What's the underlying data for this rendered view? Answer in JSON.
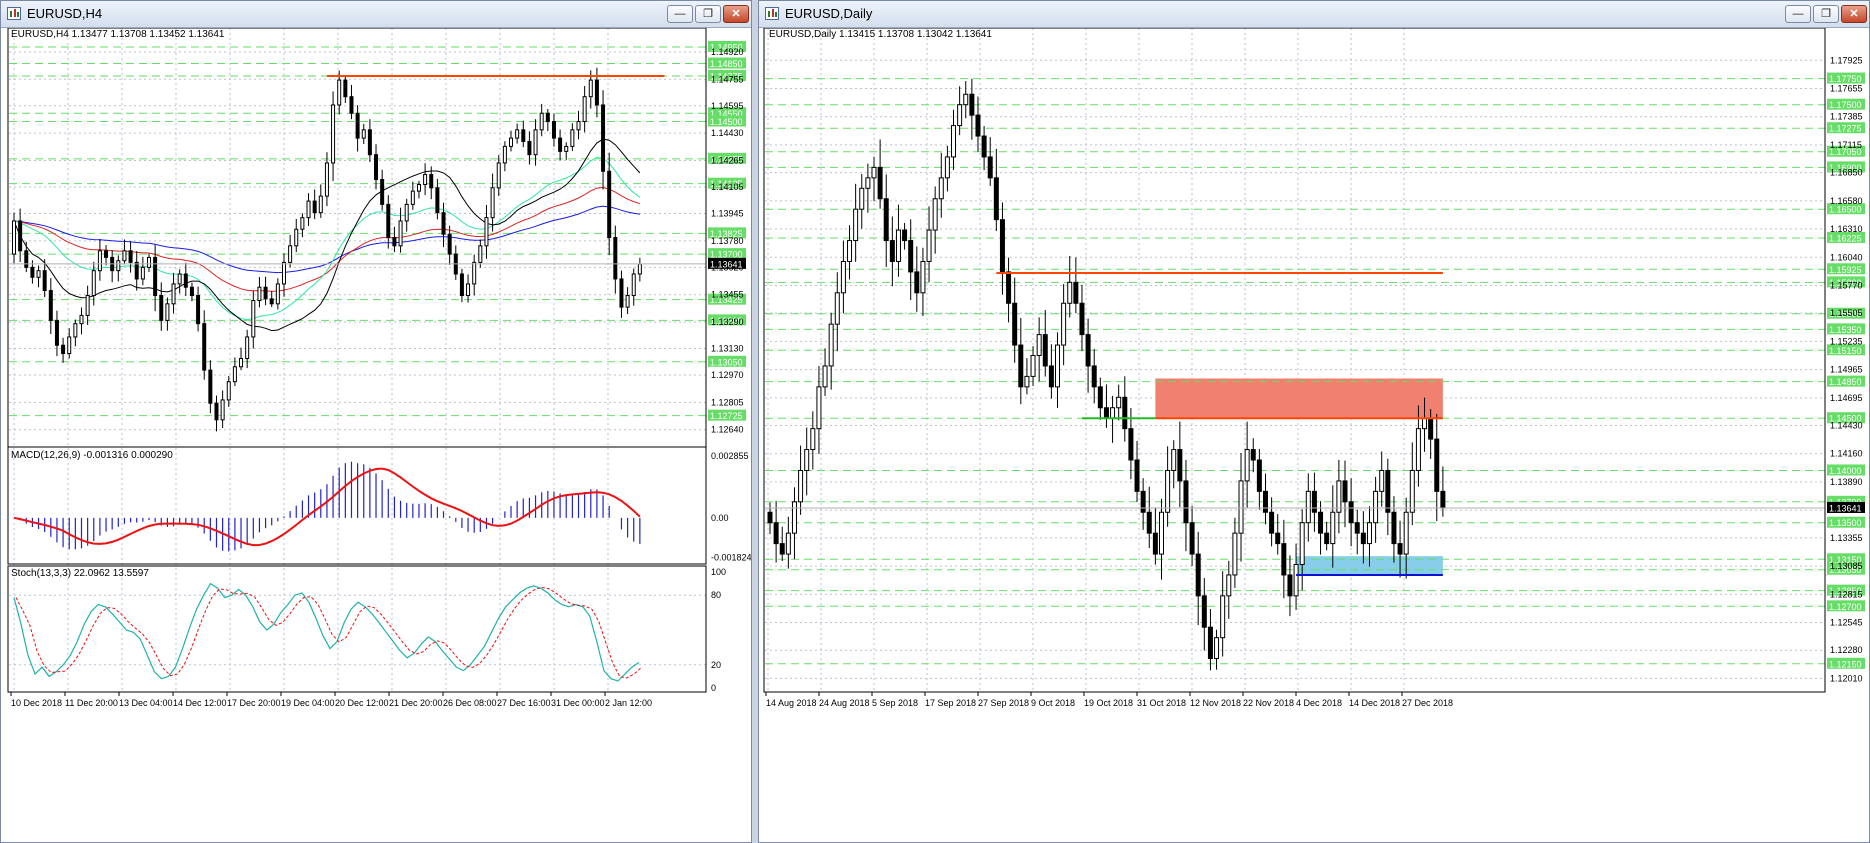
{
  "left_window": {
    "title": "EURUSD,H4",
    "header_label": "EURUSD,H4  1.13477 1.13708 1.13452 1.13641",
    "macd_label": "MACD(12,26,9) -0.001316 0.000290",
    "stoch_label": "Stoch(13,3,3) 22.0962 13.5597",
    "buttons": {
      "minimize": "—",
      "restore": "❐",
      "close": "✕"
    }
  },
  "right_window": {
    "title": "EURUSD,Daily",
    "header_label": "EURUSD,Daily  1.13415 1.13708 1.13042 1.13641",
    "buttons": {
      "minimize": "—",
      "restore": "❐",
      "close": "✕"
    }
  },
  "colors": {
    "bull": "#ffffff",
    "bear": "#000000",
    "grid": "#b9c3cf",
    "level": "#66dd66",
    "resistance": "#ff4500",
    "support_line": "#1010d0",
    "green_line": "#22bb22",
    "zone_red": "#f08070",
    "zone_blue": "#87ceeb",
    "macd_hist": "#2222cc",
    "signal": "#ee1111",
    "stoch_main": "#20b2aa",
    "stoch_signal": "#ee1111",
    "ma_black": "#000000",
    "ma_teal": "#2ee8a0",
    "ma_red": "#dd2222",
    "ma_blue": "#1a1aee"
  },
  "chart_data": [
    {
      "type": "candlestick",
      "id": "h4",
      "title": "EURUSD,H4",
      "ylim": [
        1.1256,
        1.1498
      ],
      "yticks": [
        1.1492,
        1.14755,
        1.14595,
        1.1443,
        1.14265,
        1.14105,
        1.13945,
        1.1378,
        1.1362,
        1.13455,
        1.1329,
        1.1313,
        1.1297,
        1.12805,
        1.1264
      ],
      "green_levels": [
        1.1495,
        1.1485,
        1.14775,
        1.1455,
        1.145,
        1.14275,
        1.14125,
        1.13825,
        1.137,
        1.13425,
        1.133,
        1.1305,
        1.12725
      ],
      "green_level_labels": [
        "1.14950",
        "1.14850",
        "1.14775",
        "1.14550",
        "1.14500",
        "1.14275",
        "1.14125",
        "1.13825",
        "1.13700",
        "1.13425",
        "1.13300",
        "1.13050",
        "1.12725"
      ],
      "current_price": 1.13641,
      "current_price_label": "1.13641",
      "xlabels": [
        "10 Dec 2018",
        "11 Dec 20:00",
        "13 Dec 04:00",
        "14 Dec 12:00",
        "17 Dec 20:00",
        "19 Dec 04:00",
        "20 Dec 12:00",
        "21 Dec 20:00",
        "26 Dec 08:00",
        "27 Dec 16:00",
        "31 Dec 00:00",
        "2 Jan 12:00"
      ],
      "resistance": {
        "price": 1.14775,
        "from_index": 51,
        "to_index": 106
      },
      "closes": [
        1.139,
        1.1372,
        1.1362,
        1.1356,
        1.136,
        1.1348,
        1.133,
        1.1315,
        1.131,
        1.132,
        1.1328,
        1.1333,
        1.1345,
        1.136,
        1.1372,
        1.1368,
        1.136,
        1.1366,
        1.1372,
        1.1365,
        1.1355,
        1.1362,
        1.1368,
        1.1345,
        1.133,
        1.134,
        1.1352,
        1.1358,
        1.135,
        1.1345,
        1.1328,
        1.13,
        1.128,
        1.127,
        1.1282,
        1.1293,
        1.1302,
        1.1307,
        1.132,
        1.1342,
        1.135,
        1.1343,
        1.134,
        1.1352,
        1.1365,
        1.1375,
        1.1385,
        1.1392,
        1.1402,
        1.1395,
        1.1405,
        1.1425,
        1.146,
        1.1475,
        1.1465,
        1.1455,
        1.144,
        1.1445,
        1.143,
        1.1415,
        1.14,
        1.138,
        1.1375,
        1.139,
        1.14,
        1.1408,
        1.1412,
        1.1418,
        1.141,
        1.1395,
        1.1382,
        1.137,
        1.1358,
        1.1345,
        1.1352,
        1.1365,
        1.1375,
        1.1392,
        1.141,
        1.1425,
        1.1435,
        1.144,
        1.1445,
        1.1438,
        1.143,
        1.1445,
        1.1455,
        1.145,
        1.144,
        1.1432,
        1.1435,
        1.1445,
        1.145,
        1.1465,
        1.1475,
        1.146,
        1.142,
        1.138,
        1.1355,
        1.1338,
        1.1345,
        1.1358,
        1.1364
      ]
    },
    {
      "type": "line",
      "id": "macd",
      "title": "MACD(12,26,9) -0.001316 0.000290",
      "ylim": [
        -0.00195,
        0.003
      ],
      "yticks": [
        0.002855,
        0.0,
        -0.001824
      ],
      "ytick_labels": [
        "0.002855",
        "0.00",
        "-0.001824"
      ]
    },
    {
      "type": "line",
      "id": "stoch",
      "title": "Stoch(13,3,3) 22.0962 13.5597",
      "ylim": [
        0,
        100
      ],
      "yticks": [
        100,
        80,
        20,
        0
      ],
      "ytick_labels": [
        "100",
        "80",
        "20",
        "0"
      ],
      "values": [
        78,
        55,
        28,
        12,
        18,
        10,
        14,
        20,
        28,
        40,
        55,
        66,
        72,
        70,
        64,
        57,
        50,
        48,
        42,
        28,
        14,
        8,
        10,
        18,
        34,
        52,
        68,
        80,
        90,
        86,
        78,
        80,
        85,
        80,
        70,
        57,
        50,
        55,
        65,
        72,
        80,
        82,
        74,
        60,
        45,
        34,
        40,
        56,
        68,
        74,
        70,
        64,
        56,
        48,
        40,
        32,
        26,
        30,
        38,
        44,
        40,
        32,
        25,
        18,
        15,
        20,
        28,
        36,
        48,
        60,
        70,
        76,
        82,
        86,
        88,
        86,
        82,
        76,
        72,
        70,
        72,
        70,
        62,
        40,
        15,
        8,
        6,
        12,
        18,
        22
      ]
    },
    {
      "type": "candlestick",
      "id": "daily",
      "title": "EURUSD,Daily",
      "ylim": [
        1.1188,
        1.181
      ],
      "yticks": [
        1.17925,
        1.17655,
        1.17385,
        1.17115,
        1.1685,
        1.1658,
        1.1631,
        1.1604,
        1.1577,
        1.15505,
        1.15235,
        1.14965,
        1.14695,
        1.1443,
        1.1416,
        1.1389,
        1.1362,
        1.13355,
        1.13085,
        1.12815,
        1.12545,
        1.1228,
        1.1201
      ],
      "green_levels": [
        1.1775,
        1.175,
        1.17275,
        1.1705,
        1.169,
        1.165,
        1.16225,
        1.15925,
        1.158,
        1.155,
        1.1535,
        1.1515,
        1.1485,
        1.145,
        1.14,
        1.137,
        1.135,
        1.1315,
        1.1305,
        1.1285,
        1.127,
        1.1215
      ],
      "green_level_labels": [
        "1.17750",
        "1.17500",
        "1.17275",
        "1.17050",
        "1.16900",
        "1.16500",
        "1.16225",
        "1.15925",
        "1.15800",
        "1.15500",
        "1.15350",
        "1.15150",
        "1.14850",
        "1.14500",
        "1.14000",
        "1.13700",
        "1.13500",
        "1.13150",
        "1.13050",
        "1.12850",
        "1.12700",
        "1.12150"
      ],
      "current_price": 1.13641,
      "current_price_label": "1.13641",
      "xlabels": [
        "14 Aug 2018",
        "24 Aug 2018",
        "5 Sep 2018",
        "17 Sep 2018",
        "27 Sep 2018",
        "9 Oct 2018",
        "19 Oct 2018",
        "31 Oct 2018",
        "12 Nov 2018",
        "22 Nov 2018",
        "4 Dec 2018",
        "14 Dec 2018",
        "27 Dec 2018"
      ],
      "resistance": {
        "price": 1.1589,
        "from_index": 37,
        "to_index": 110
      },
      "support_green": {
        "price": 1.145,
        "from_index": 51,
        "to_index": 63
      },
      "red_zone": {
        "top": 1.1488,
        "bottom": 1.145,
        "from_index": 63,
        "to_index": 110
      },
      "blue_zone": {
        "top": 1.1318,
        "bottom": 1.13,
        "from_index": 86,
        "to_index": 110
      },
      "closes": [
        1.135,
        1.133,
        1.132,
        1.134,
        1.137,
        1.14,
        1.142,
        1.144,
        1.148,
        1.15,
        1.154,
        1.157,
        1.16,
        1.162,
        1.165,
        1.167,
        1.168,
        1.169,
        1.166,
        1.162,
        1.16,
        1.163,
        1.162,
        1.159,
        1.157,
        1.16,
        1.163,
        1.166,
        1.168,
        1.17,
        1.173,
        1.175,
        1.176,
        1.174,
        1.172,
        1.17,
        1.168,
        1.164,
        1.159,
        1.156,
        1.152,
        1.148,
        1.149,
        1.151,
        1.153,
        1.15,
        1.148,
        1.152,
        1.156,
        1.158,
        1.156,
        1.153,
        1.15,
        1.148,
        1.146,
        1.145,
        1.146,
        1.147,
        1.144,
        1.141,
        1.138,
        1.136,
        1.134,
        1.132,
        1.136,
        1.14,
        1.142,
        1.139,
        1.135,
        1.132,
        1.128,
        1.125,
        1.122,
        1.124,
        1.128,
        1.13,
        1.134,
        1.139,
        1.142,
        1.141,
        1.138,
        1.136,
        1.134,
        1.133,
        1.13,
        1.128,
        1.131,
        1.135,
        1.138,
        1.136,
        1.134,
        1.133,
        1.136,
        1.139,
        1.137,
        1.135,
        1.134,
        1.133,
        1.135,
        1.138,
        1.14,
        1.136,
        1.133,
        1.132,
        1.136,
        1.14,
        1.144,
        1.145,
        1.143,
        1.138,
        1.1364
      ]
    }
  ]
}
